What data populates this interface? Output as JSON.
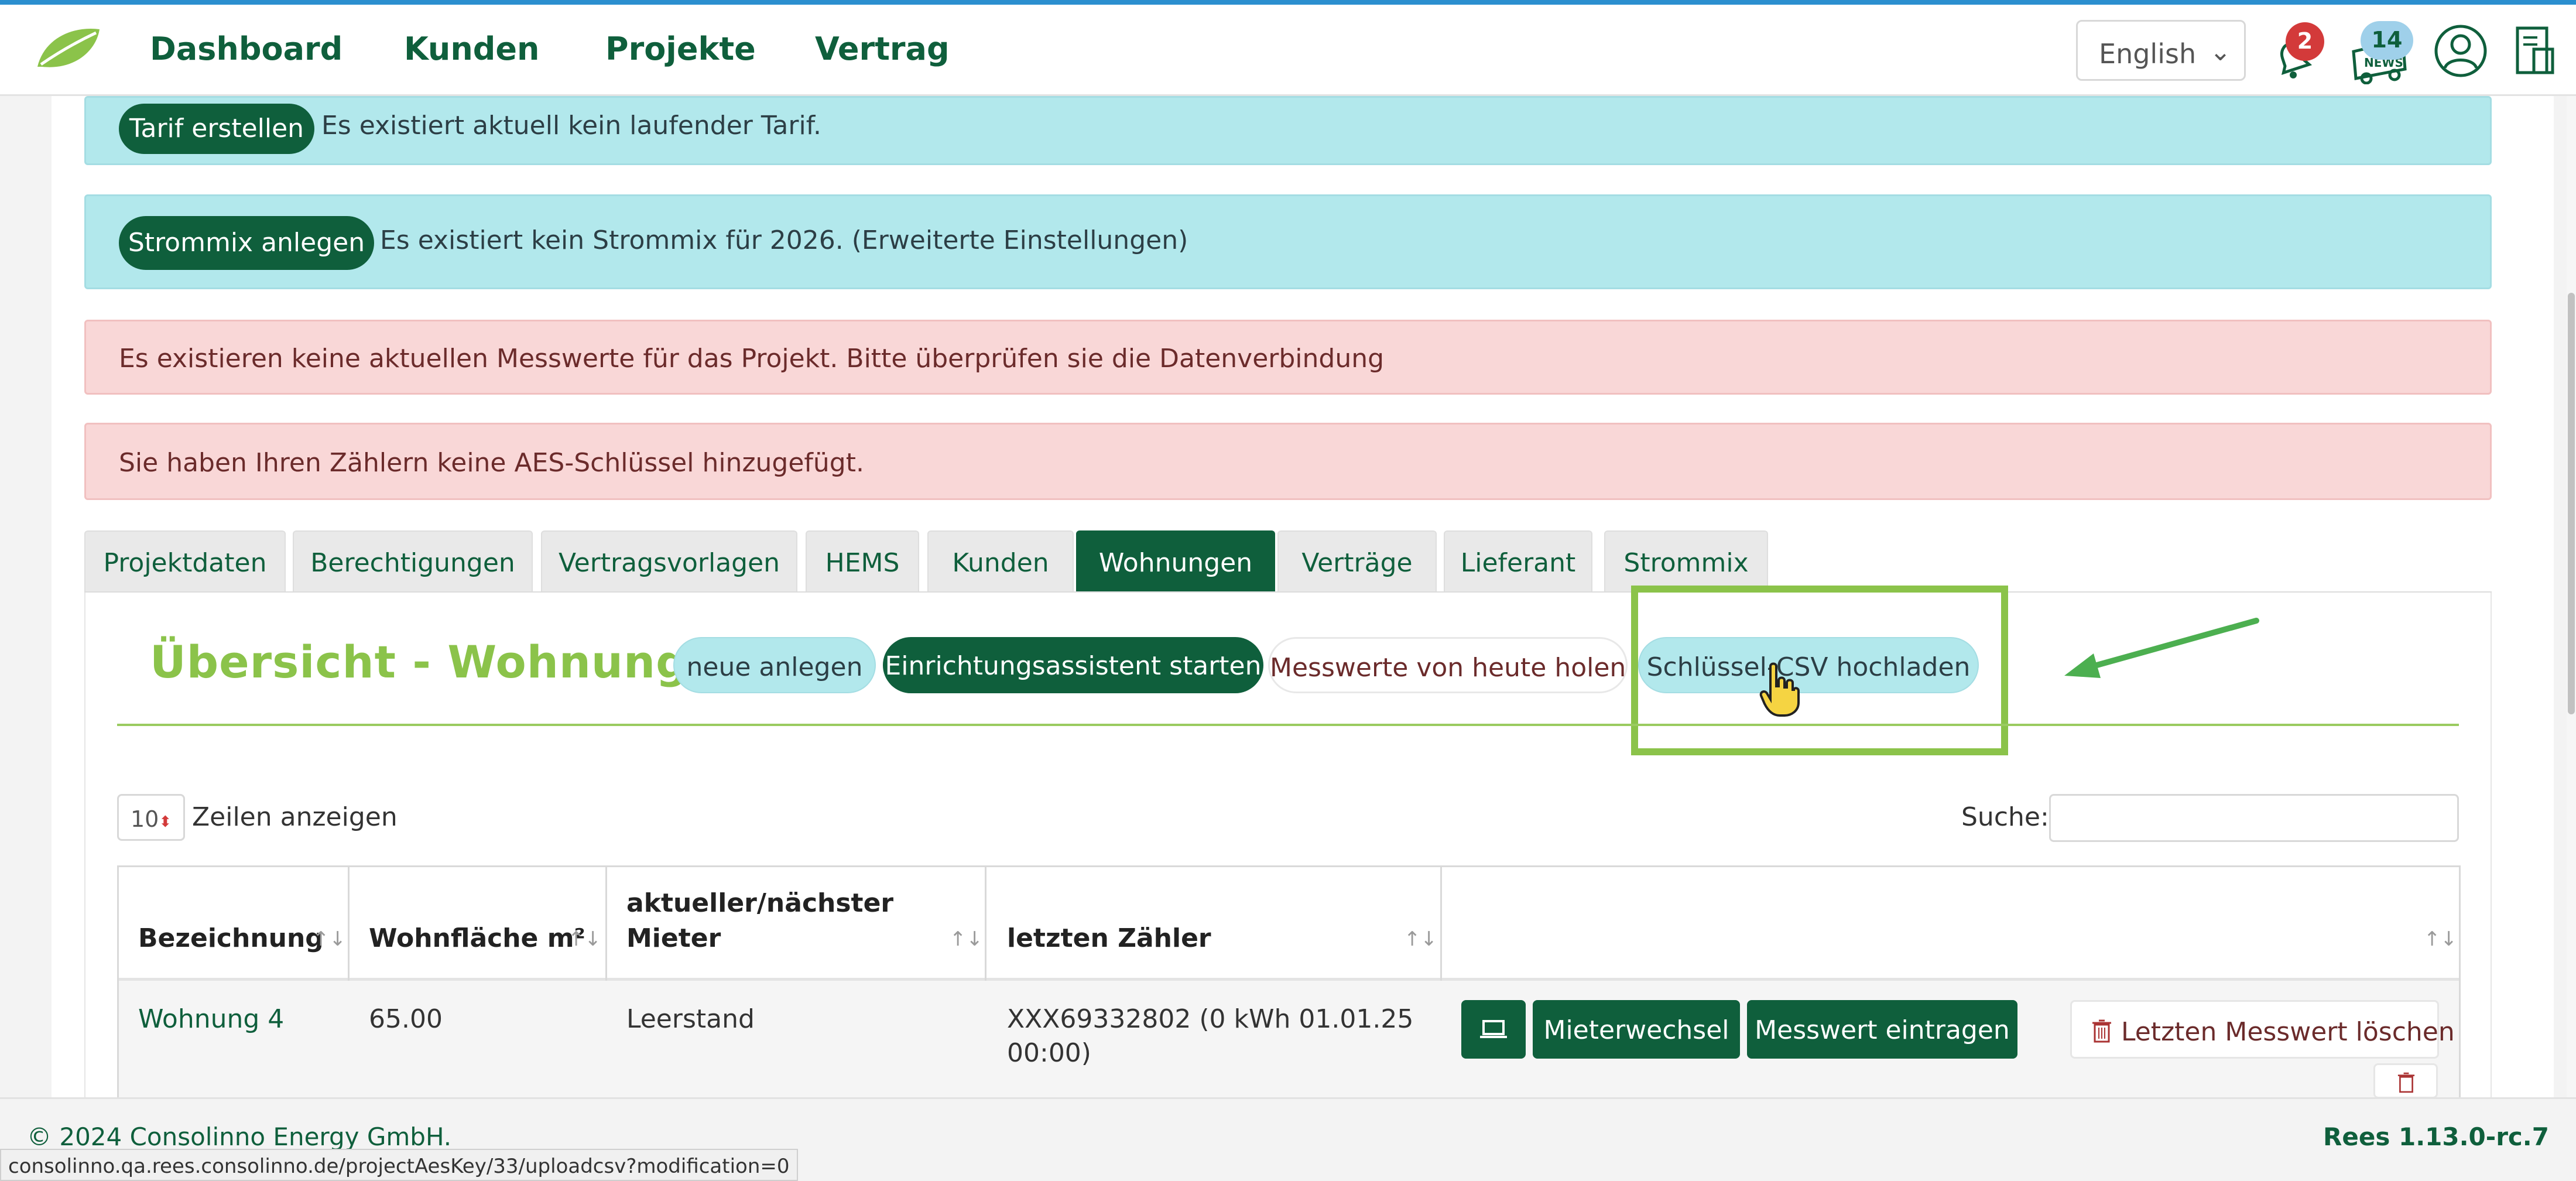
{
  "nav": {
    "items": [
      "Dashboard",
      "Kunden",
      "Projekte",
      "Vertrag"
    ],
    "language": "English",
    "notifications_count": "2",
    "news_count": "14",
    "news_label": "NEWS"
  },
  "alerts": {
    "tarif_button": "Tarif erstellen",
    "tarif_text": "Es existiert aktuell kein laufender Tarif.",
    "strommix_button": "Strommix anlegen",
    "strommix_text": "Es existiert kein Strommix für 2026. (Erweiterte Einstellungen)",
    "messwerte_text": "Es existieren keine aktuellen Messwerte für das Projekt. Bitte überprüfen sie die Datenverbindung",
    "aes_text": "Sie haben Ihren Zählern keine AES-Schlüssel hinzugefügt."
  },
  "tabs": [
    "Projektdaten",
    "Berechtigungen",
    "Vertragsvorlagen",
    "HEMS",
    "Kunden",
    "Wohnungen",
    "Verträge",
    "Lieferant",
    "Strommix"
  ],
  "active_tab": "Wohnungen",
  "overview": {
    "title": "Übersicht - Wohnungen",
    "btn_new": "neue anlegen",
    "btn_wizard": "Einrichtungsassistent starten",
    "btn_fetch": "Messwerte von heute holen",
    "btn_upload": "Schlüssel-CSV hochladen"
  },
  "table_controls": {
    "page_length": "10",
    "page_length_label": "Zeilen anzeigen",
    "search_label": "Suche:"
  },
  "table": {
    "headers": [
      "Bezeichnung",
      "Wohnfläche m²",
      "aktueller/nächster Mieter",
      "letzten Zähler",
      ""
    ],
    "header_mieter_line1": "aktueller/nächster",
    "header_mieter_line2": "Mieter",
    "rows": [
      {
        "bezeichnung": "Wohnung 4",
        "wohnflaeche": "65.00",
        "mieter": "Leerstand",
        "zaehler_line1": "XXX69332802 (0 kWh 01.01.25",
        "zaehler_line2": "00:00)",
        "btn_mieterwechsel": "Mieterwechsel",
        "btn_messwert": "Messwert eintragen",
        "btn_loeschen": "Letzten Messwert löschen"
      }
    ]
  },
  "footer": {
    "copyright": "© 2024 Consolinno Energy GmbH.",
    "version": "Rees 1.13.0-rc.7"
  },
  "status_url": "consolinno.qa.rees.consolinno.de/projectAesKey/33/uploadcsv?modification=0",
  "colors": {
    "brand_dark": "#0f5f3c",
    "brand_light": "#8bc34a",
    "info_bg": "#b2e8ec",
    "danger_bg": "#f9d7d7",
    "badge_red": "#d33a3a",
    "badge_blue": "#6fb2d8"
  }
}
